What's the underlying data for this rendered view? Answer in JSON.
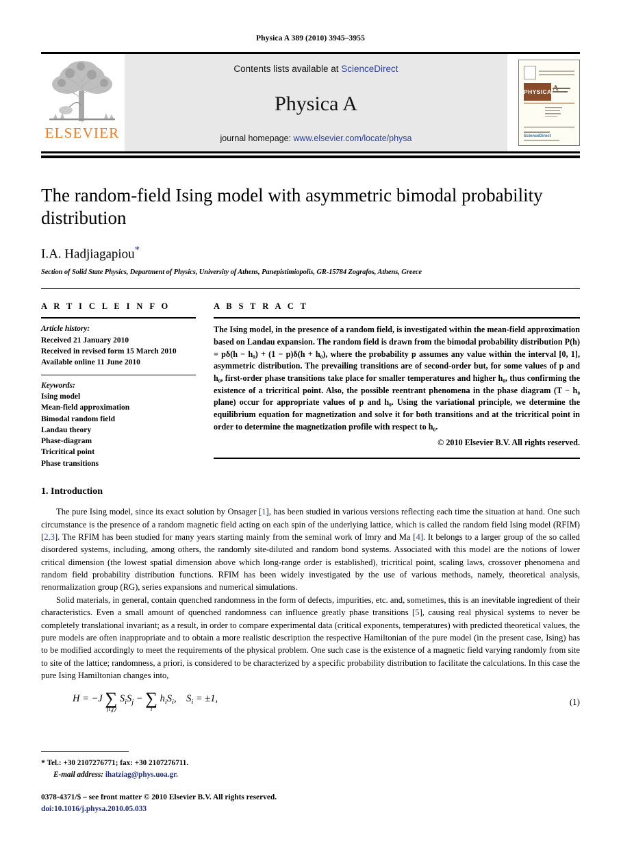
{
  "running_head": "Physica A 389 (2010) 3945–3955",
  "masthead": {
    "publisher_wordmark": "ELSEVIER",
    "contents_prefix": "Contents lists available at",
    "contents_link": "ScienceDirect",
    "journal_name": "Physica A",
    "homepage_prefix": "journal homepage:",
    "homepage_link": "www.elsevier.com/locate/physa",
    "cover": {
      "banner_title": "PHYSICA",
      "banner_letter": "A",
      "sciencedirect": "ScienceDirect"
    },
    "link_color": "#2b3fa0",
    "band_color": "#e8e8e8",
    "elsevier_orange": "#F47A20"
  },
  "article": {
    "title": "The random-field Ising model with asymmetric bimodal probability distribution",
    "author": "I.A. Hadjiagapiou",
    "author_marker": "*",
    "affiliation": "Section of Solid State Physics, Department of Physics, University of Athens, Panepistimiopolis, GR-15784 Zografos, Athens, Greece"
  },
  "article_info": {
    "heading": "A R T I C L E   I N F O",
    "history_label": "Article history:",
    "history": [
      "Received 21 January 2010",
      "Received in revised form 15 March 2010",
      "Available online 11 June 2010"
    ],
    "keywords_label": "Keywords:",
    "keywords": [
      "Ising model",
      "Mean-field approximation",
      "Bimodal random field",
      "Landau theory",
      "Phase-diagram",
      "Tricritical point",
      "Phase transitions"
    ]
  },
  "abstract": {
    "heading": "A B S T R A C T",
    "text_part1": "The Ising model, in the presence of a random field, is investigated within the mean-field approximation based on Landau expansion. The random field is drawn from the bimodal probability distribution ",
    "formula": "P(h) = pδ(h − h₀) + (1 − p)δ(h + h₀)",
    "text_part2": ", where the probability p assumes any value within the interval [0, 1], asymmetric distribution. The prevailing transitions are of second-order but, for some values of p and h₀, first-order phase transitions take place for smaller temperatures and higher h₀, thus confirming the existence of a tricritical point. Also, the possible reentrant phenomena in the phase diagram (T − h₀ plane) occur for appropriate values of p and h₀. Using the variational principle, we determine the equilibrium equation for magnetization and solve it for both transitions and at the tricritical point in order to determine the magnetization profile with respect to h₀.",
    "copyright": "© 2010 Elsevier B.V. All rights reserved."
  },
  "introduction": {
    "heading": "1.  Introduction",
    "paragraph1_a": "The pure Ising model, since its exact solution by Onsager [",
    "ref1": "1",
    "paragraph1_b": "], has been studied in various versions reflecting each time the situation at hand. One such circumstance is the presence of a random magnetic field acting on each spin of the underlying lattice, which is called the random field Ising model (RFIM) [",
    "ref23": "2,3",
    "paragraph1_c": "]. The RFIM has been studied for many years starting mainly from the seminal work of Imry and Ma [",
    "ref4": "4",
    "paragraph1_d": "]. It belongs to a larger group of the so called disordered systems, including, among others, the randomly site-diluted and random bond systems. Associated with this model are the notions of lower critical dimension (the lowest spatial dimension above which long-range order is established), tricritical point, scaling laws, crossover phenomena and random field probability distribution functions. RFIM has been widely investigated by the use of various methods, namely, theoretical analysis, renormalization group (RG), series expansions and numerical simulations.",
    "paragraph2_a": "Solid materials, in general, contain quenched randomness in the form of defects, impurities, etc. and, sometimes, this is an inevitable ingredient of their characteristics. Even a small amount of quenched randomness can influence greatly phase transitions [",
    "ref5": "5",
    "paragraph2_b": "], causing real physical systems to never be completely translational invariant; as a result, in order to compare experimental data (critical exponents, temperatures) with predicted theoretical values, the pure models are often inappropriate and to obtain a more realistic description the respective Hamiltonian of the pure model (in the present case, Ising) has to be modified accordingly to meet the requirements of the physical problem. One such case is the existence of a magnetic field varying randomly from site to site of the lattice; randomness, a priori, is considered to be characterized by a specific probability distribution to facilitate the calculations. In this case the pure Ising Hamiltonian changes into,"
  },
  "equation": {
    "number": "(1)",
    "lhs": "H = −J",
    "sum1_limits": "⟨i,j⟩",
    "term1": "SiSj",
    "minus": "−",
    "sum2_limits": "i",
    "term2": "hiSi,",
    "constraint": "Si = ±1,"
  },
  "footnotes": {
    "star": "*",
    "contact": "Tel.: +30 2107276771; fax: +30 2107276711.",
    "email_label": "E-mail address:",
    "email": "ihatziag@phys.uoa.gr.",
    "imprint": "0378-4371/$ – see front matter © 2010 Elsevier B.V. All rights reserved.",
    "doi": "doi:10.1016/j.physa.2010.05.033"
  }
}
